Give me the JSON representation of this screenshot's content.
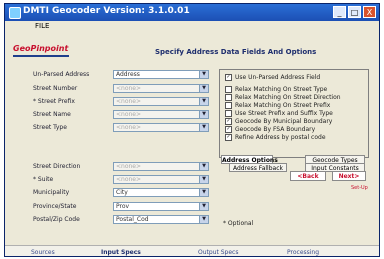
{
  "window": {
    "title": "DMTI Geocoder  Version: 3.1.0.01",
    "menu": [
      "FILE"
    ],
    "controls": [
      "_",
      "□",
      "X"
    ]
  },
  "logo": "GeoPinpoint",
  "heading": "Specify Address Data Fields And Options",
  "fields": [
    {
      "label": "Un-Parsed Address",
      "value": "Address",
      "disabled": false
    },
    {
      "label": "Street Number",
      "value": "<none>",
      "disabled": true
    },
    {
      "label": "* Street Prefix",
      "value": "<none>",
      "disabled": true
    },
    {
      "label": "Street Name",
      "value": "<none>",
      "disabled": true
    },
    {
      "label": "Street Type",
      "value": "<none>",
      "disabled": true
    },
    {
      "label": "Street Direction",
      "value": "<none>",
      "disabled": true
    },
    {
      "label": "* Suite",
      "value": "<none>",
      "disabled": true
    },
    {
      "label": "Municipality",
      "value": "City",
      "disabled": false
    },
    {
      "label": "Province/State",
      "value": "Prov",
      "disabled": false
    },
    {
      "label": "Postal/Zip Code",
      "value": "Postal_Cod",
      "disabled": false
    }
  ],
  "options": [
    {
      "label": "Use Un-Parsed Address Field",
      "checked": true
    },
    {
      "label": "Relax Matching On Street Type",
      "checked": false
    },
    {
      "label": "Relax Matching On Street Direction",
      "checked": false
    },
    {
      "label": "Relax Matching On Street Prefix",
      "checked": false
    },
    {
      "label": "Use Street Prefix and Suffix Type",
      "checked": false
    },
    {
      "label": "Geocode By Municipal Boundary",
      "checked": true
    },
    {
      "label": "Geocode By FSA Boundary",
      "checked": true
    },
    {
      "label": "Refine Address by postal code",
      "checked": true
    }
  ],
  "option_tabs": [
    "Address Options",
    "Geocode Types",
    "Address Fallback",
    "Input Constants"
  ],
  "nav": {
    "back": "<Back",
    "next": "Next>"
  },
  "setup_link": "Set-Up",
  "optional_note": "* Optional",
  "bottom_tabs": [
    "Sources",
    "Input Specs",
    "Output Specs",
    "Processing"
  ]
}
